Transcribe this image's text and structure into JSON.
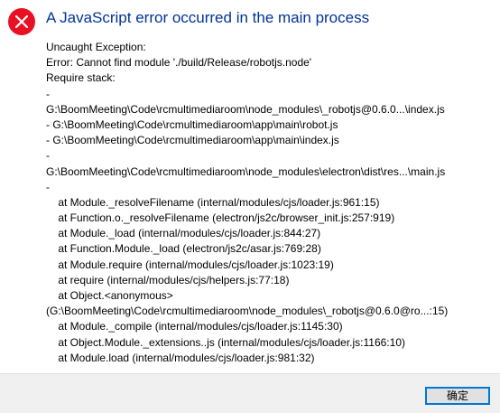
{
  "dialog": {
    "icon": "error-icon",
    "title": "A JavaScript error occurred in the main process",
    "lines": [
      "Uncaught Exception:",
      "Error: Cannot find module './build/Release/robotjs.node'",
      "Require stack:",
      "-",
      "G:\\BoomMeeting\\Code\\rcmultimediaroom\\node_modules\\_robotjs@0.6.0...\\index.js",
      "- G:\\BoomMeeting\\Code\\rcmultimediaroom\\app\\main\\robot.js",
      "- G:\\BoomMeeting\\Code\\rcmultimediaroom\\app\\main\\index.js",
      "-",
      "G:\\BoomMeeting\\Code\\rcmultimediaroom\\node_modules\\electron\\dist\\res...\\main.js",
      "-",
      "    at Module._resolveFilename (internal/modules/cjs/loader.js:961:15)",
      "    at Function.o._resolveFilename (electron/js2c/browser_init.js:257:919)",
      "    at Module._load (internal/modules/cjs/loader.js:844:27)",
      "    at Function.Module._load (electron/js2c/asar.js:769:28)",
      "    at Module.require (internal/modules/cjs/loader.js:1023:19)",
      "    at require (internal/modules/cjs/helpers.js:77:18)",
      "    at Object.<anonymous>",
      "(G:\\BoomMeeting\\Code\\rcmultimediaroom\\node_modules\\_robotjs@0.6.0@ro...:15)",
      "    at Module._compile (internal/modules/cjs/loader.js:1145:30)",
      "    at Object.Module._extensions..js (internal/modules/cjs/loader.js:1166:10)",
      "    at Module.load (internal/modules/cjs/loader.js:981:32)"
    ],
    "ok_label": "确定"
  },
  "colors": {
    "title": "#003399",
    "icon_background": "#e81123",
    "footer_background": "#f0f0f0",
    "button_border": "#0078d7"
  }
}
